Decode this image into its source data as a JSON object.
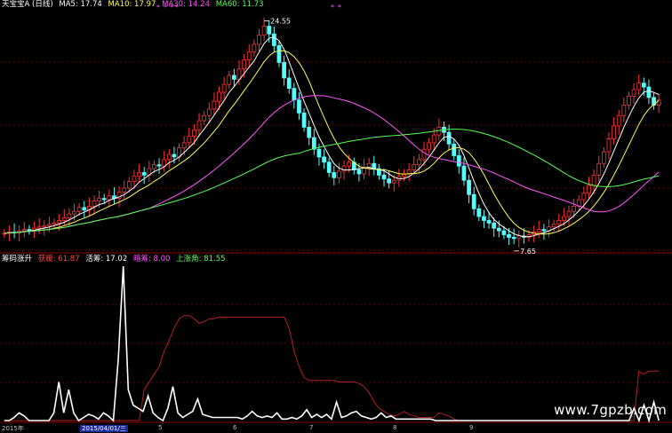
{
  "main_header": {
    "title": "天宝宝A (日线)",
    "ma5_label": "MA5: 17.74",
    "ma10_label": "MA10: 17.97",
    "ma30_label": "MA30: 14.24",
    "ma60_label": "MA60: 11.73"
  },
  "sub_header": {
    "title": "筹码涨升",
    "l1_label": "获暖: 61.87",
    "l2_label": "活筹: 17.02",
    "l3_label": "暗筹: 8.00",
    "l4_label": "上涨角: 81.55"
  },
  "annotations": {
    "high": "24.55",
    "low": "7.65"
  },
  "date_axis": {
    "start": "2015年",
    "highlight": "2015/04/01/三",
    "ticks": [
      "5",
      "6",
      "7",
      "8",
      "9"
    ]
  },
  "watermark": "www.7gpzb.com",
  "colors": {
    "up": "#ff3333",
    "down": "#54ffff",
    "ma5": "#ffffff",
    "ma10": "#ffff55",
    "ma30": "#ff55ff",
    "ma60": "#55ff55",
    "sub_white": "#ffffff",
    "sub_red": "#b02020",
    "grid": "#8a0000"
  },
  "chart_data": [
    {
      "type": "candlestick",
      "title": "天宝宝A (日线)",
      "y_range": [
        7.0,
        25.5
      ],
      "closes": [
        8.3,
        8.4,
        8.35,
        8.5,
        8.6,
        8.55,
        8.7,
        8.8,
        8.9,
        9.0,
        9.1,
        9.3,
        9.5,
        9.8,
        10.0,
        10.3,
        10.1,
        10.4,
        10.8,
        11.0,
        10.9,
        11.2,
        11.0,
        11.5,
        11.8,
        12.3,
        12.7,
        13.0,
        12.8,
        13.3,
        13.6,
        13.5,
        14.0,
        14.4,
        14.2,
        14.9,
        15.3,
        15.8,
        16.3,
        17.0,
        17.4,
        17.9,
        18.5,
        19.2,
        19.8,
        20.5,
        20.2,
        21.0,
        21.7,
        22.3,
        22.9,
        23.6,
        24.3,
        23.7,
        22.8,
        21.5,
        20.3,
        19.5,
        18.6,
        17.6,
        16.5,
        15.7,
        14.8,
        14.2,
        13.8,
        13.0,
        12.6,
        13.1,
        13.5,
        13.8,
        13.2,
        12.9,
        13.4,
        13.7,
        13.3,
        12.8,
        12.5,
        12.2,
        12.4,
        12.7,
        12.9,
        13.2,
        13.6,
        14.0,
        14.8,
        15.3,
        15.9,
        16.5,
        16.1,
        15.2,
        14.3,
        13.5,
        12.4,
        11.3,
        10.2,
        9.6,
        9.3,
        9.1,
        8.7,
        8.5,
        8.2,
        8.0,
        7.9,
        8.1,
        8.0,
        8.2,
        8.4,
        8.6,
        8.5,
        8.8,
        9.0,
        9.3,
        9.6,
        10.0,
        10.4,
        10.9,
        11.4,
        12.0,
        12.8,
        13.7,
        14.6,
        15.6,
        16.6,
        17.4,
        18.2,
        18.9,
        19.4,
        19.9,
        19.6,
        18.8,
        18.2,
        18.6
      ]
    },
    {
      "type": "line",
      "title": "筹码涨升",
      "series": [
        {
          "name": "获暖",
          "values": [
            0,
            0,
            0,
            0,
            0,
            0,
            0,
            0,
            0,
            0,
            0,
            0,
            0,
            0,
            0,
            0,
            0,
            0,
            0,
            0,
            0,
            0,
            0,
            0,
            0,
            0,
            0,
            0,
            0.2,
            0.25,
            0.3,
            0.35,
            0.45,
            0.52,
            0.6,
            0.66,
            0.68,
            0.68,
            0.66,
            0.63,
            0.64,
            0.66,
            0.66,
            0.67,
            0.67,
            0.67,
            0.67,
            0.67,
            0.67,
            0.67,
            0.67,
            0.67,
            0.67,
            0.67,
            0.67,
            0.67,
            0.67,
            0.6,
            0.45,
            0.35,
            0.28,
            0.26,
            0.26,
            0.26,
            0.26,
            0.26,
            0.26,
            0.25,
            0.25,
            0.25,
            0.25,
            0.24,
            0.22,
            0.18,
            0.12,
            0.08,
            0.06,
            0.04,
            0.03,
            0.04,
            0.06,
            0.04,
            0.03,
            0.02,
            0.02,
            0.02,
            0.02,
            0.05,
            0.04,
            0.03,
            0.01,
            0,
            0,
            0,
            0,
            0,
            0,
            0,
            0,
            0,
            0,
            0,
            0,
            0,
            0,
            0,
            0,
            0,
            0,
            0,
            0,
            0,
            0,
            0,
            0,
            0,
            0,
            0,
            0,
            0,
            0,
            0,
            0,
            0,
            0,
            0,
            0,
            0.32,
            0.3,
            0.32,
            0.32,
            0.32
          ]
        },
        {
          "name": "活筹",
          "values": [
            0,
            0,
            0.02,
            0.05,
            0.03,
            0,
            0,
            0,
            0,
            0,
            0.05,
            0.25,
            0.05,
            0.2,
            0.05,
            0,
            0.02,
            0.04,
            0.03,
            0.01,
            0.05,
            0.03,
            0,
            0.4,
            1.0,
            0.2,
            0.1,
            0.08,
            0.06,
            0.16,
            0.05,
            0.02,
            0,
            0.08,
            0.22,
            0.05,
            0.02,
            0.04,
            0.06,
            0.14,
            0.04,
            0.03,
            0.02,
            0.02,
            0.02,
            0.02,
            0.02,
            0.02,
            0.01,
            0.03,
            0.06,
            0.03,
            0.02,
            0.03,
            0.02,
            0.05,
            0.01,
            0.01,
            0.02,
            0.01,
            0.03,
            0.07,
            0.02,
            0.04,
            0.02,
            0.04,
            0.01,
            0.12,
            0.02,
            0.03,
            0.05,
            0.06,
            0.03,
            0.02,
            0.01,
            0.02,
            0.05,
            0.02,
            0.03,
            0.01,
            0.01,
            0.01,
            0.01,
            0.01,
            0.01,
            0.01,
            0.01,
            0,
            0,
            0,
            0,
            0,
            0,
            0,
            0,
            0,
            0,
            0,
            0,
            0,
            0,
            0,
            0,
            0,
            0,
            0,
            0,
            0,
            0,
            0,
            0,
            0,
            0,
            0,
            0,
            0,
            0,
            0,
            0,
            0,
            0,
            0,
            0,
            0,
            0,
            0,
            0,
            0.08,
            0,
            0.1,
            0,
            0.12,
            0
          ]
        }
      ]
    }
  ]
}
